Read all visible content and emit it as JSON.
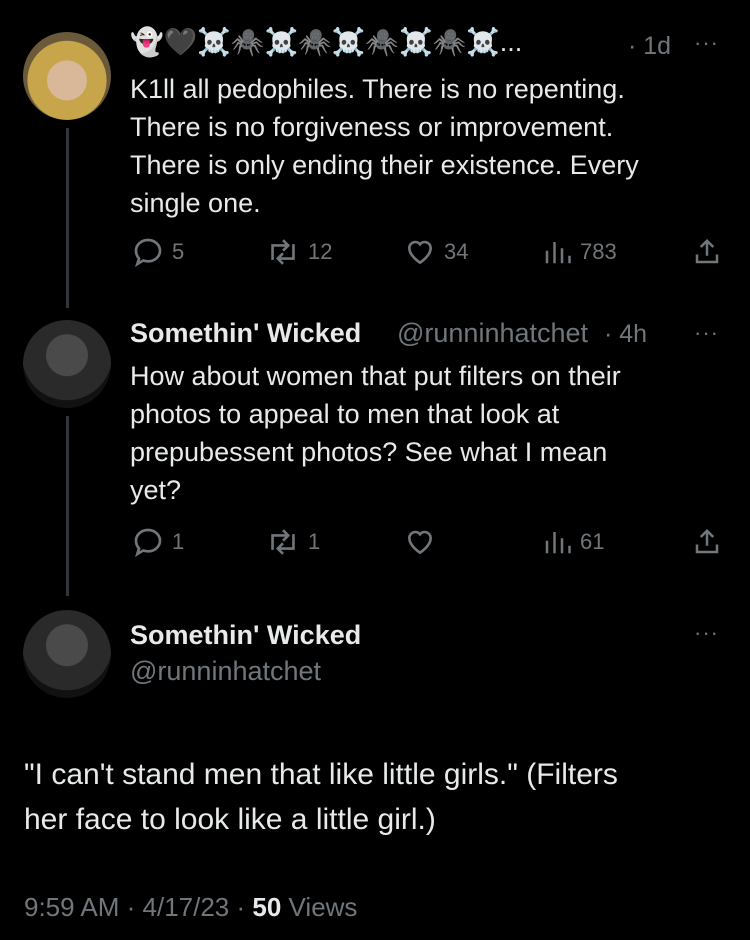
{
  "colors": {
    "background": "#000000",
    "text": "#e7e9ea",
    "muted": "#71767b",
    "thread_line": "#333639"
  },
  "tweet1": {
    "display_name": "👻🖤☠️🕷️☠️🕷️☠️🕷️☠️🕷️☠️...",
    "time": "· 1d",
    "text": "K1ll all pedophiles. There is no repenting.\nThere is no forgiveness or improvement.\nThere is only ending their existence. Every\nsingle one.",
    "replies": "5",
    "retweets": "12",
    "likes": "34",
    "views": "783",
    "more_label": "···"
  },
  "tweet2": {
    "display_name": "Somethin' Wicked",
    "handle": "@runninhatchet",
    "time": "· 4h",
    "text": "How about women that put filters on their\nphotos to appeal to men that look at\nprepubessent photos?  See what I mean\nyet?",
    "replies": "1",
    "retweets": "1",
    "likes": "",
    "views": "61",
    "more_label": "···"
  },
  "main": {
    "display_name": "Somethin' Wicked",
    "handle": "@runninhatchet",
    "text": "\"I can't stand men that like little girls.\" (Filters\nher face to look like a little girl.)",
    "time": "9:59 AM",
    "date": "· 4/17/23 ·",
    "views_count": "50",
    "views_label": "Views",
    "more_label": "···"
  },
  "icons": [
    "reply-icon",
    "retweet-icon",
    "like-icon",
    "views-icon",
    "share-icon",
    "more-icon"
  ]
}
